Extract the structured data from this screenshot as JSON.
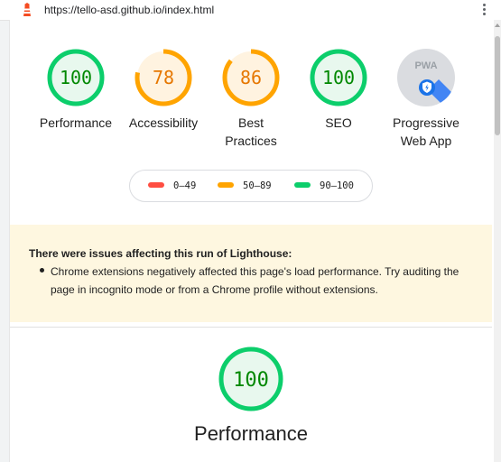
{
  "browser": {
    "url": "https://tello-asd.github.io/index.html",
    "logo_icon": "lighthouse-icon",
    "menu_icon": "kebab-menu-icon"
  },
  "gauges": [
    {
      "score": "100",
      "label": "Performance",
      "value": 100,
      "color": "#0cce6b",
      "fill": "#e8f8ee"
    },
    {
      "score": "78",
      "label": "Accessibility",
      "value": 78,
      "color": "#ffa400",
      "fill": "#fff3e0"
    },
    {
      "score": "86",
      "label_line1": "Best",
      "label_line2": "Practices",
      "value": 86,
      "color": "#ffa400",
      "fill": "#fff3e0"
    },
    {
      "score": "100",
      "label": "SEO",
      "value": 100,
      "color": "#0cce6b",
      "fill": "#e8f8ee"
    },
    {
      "badge_text": "PWA",
      "label_line1": "Progressive",
      "label_line2": "Web App",
      "badge_icon": "pwa-badge-icon"
    }
  ],
  "legend": [
    {
      "range": "0–49",
      "color": "#ff4e42"
    },
    {
      "range": "50–89",
      "color": "#ffa400"
    },
    {
      "range": "90–100",
      "color": "#0cce6b"
    }
  ],
  "warning": {
    "title": "There were issues affecting this run of Lighthouse:",
    "items": [
      "Chrome extensions negatively affected this page's load performance. Try auditing the page in incognito mode or from a Chrome profile without extensions."
    ]
  },
  "section": {
    "score": "100",
    "value": 100,
    "title": "Performance",
    "color": "#0cce6b",
    "fill": "#e8f8ee"
  }
}
